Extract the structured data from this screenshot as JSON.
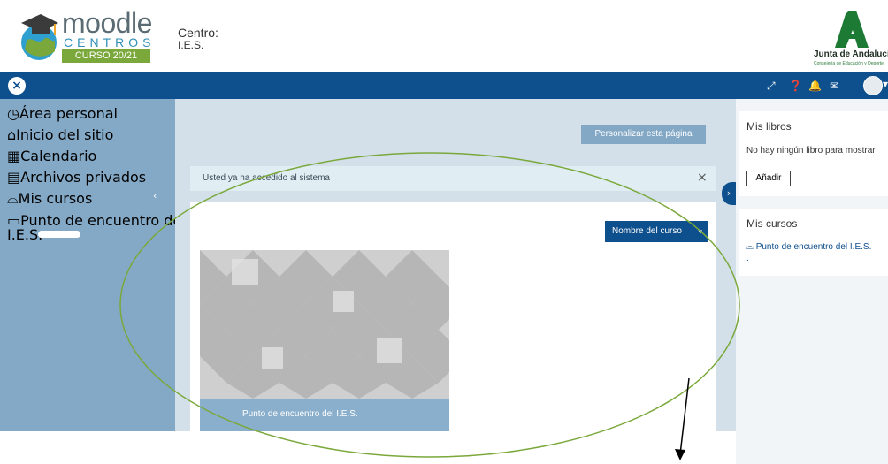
{
  "header": {
    "logo_brand": "moodle",
    "logo_sub": "CENTROS",
    "logo_year": "CURSO 20/21",
    "centro_label": "Centro:",
    "centro_name": "I.E.S.",
    "junta_name": "Junta de Andalucía",
    "junta_sub": "Consejería de Educación y Deporte"
  },
  "navbar": {
    "icons": [
      "expand-icon",
      "help-icon",
      "bell-icon",
      "mail-icon",
      "avatar"
    ]
  },
  "drawer": {
    "items": [
      {
        "label": "Área personal",
        "icon": "dashboard-icon"
      },
      {
        "label": "Inicio del sitio",
        "icon": "home-icon"
      },
      {
        "label": "Calendario",
        "icon": "calendar-icon"
      },
      {
        "label": "Archivos privados",
        "icon": "file-icon"
      },
      {
        "label": "Mis cursos",
        "icon": "graduation-cap-icon"
      },
      {
        "label": "Punto de encuentro del",
        "icon": "folder-icon"
      },
      {
        "label": "I.E.S."
      }
    ]
  },
  "main": {
    "customize_label": "Personalizar esta página",
    "alert_message": "Usted ya ha accedido al sistema",
    "alert_close": "×",
    "sort_label": "Nombre del curso",
    "course_tile_label": "Punto de encuentro del I.E.S."
  },
  "blocks": {
    "libros_title": "Mis libros",
    "libros_empty": "No hay ningún libro para mostrar",
    "add_label": "Añadir",
    "cursos_title": "Mis cursos",
    "course_link": "Punto de encuentro del I.E.S. ."
  },
  "colors": {
    "navbar": "#0e4f8d",
    "drawer": "#84a9c6",
    "main_bg": "#d3e0ea",
    "annotation": "#7aa83a"
  }
}
